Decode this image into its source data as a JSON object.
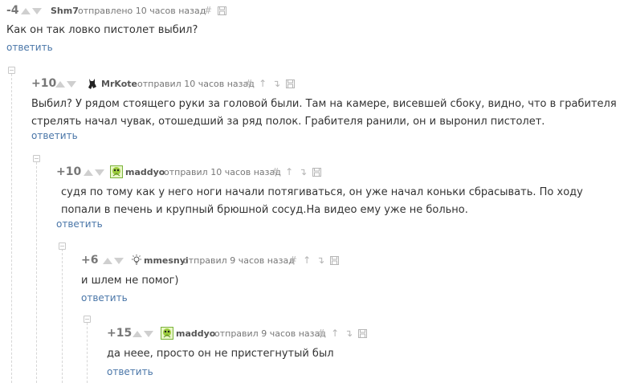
{
  "colors": {
    "reply_link": "#4a76a8",
    "vote_arrow": "#cfcfcf",
    "meta_text": "#777777"
  },
  "comments": [
    {
      "rating": "-4",
      "username": "Shm7",
      "meta": "отправлено 10 часов назад",
      "avatar_icon": "none",
      "text": "Как он так ловко пистолет выбил?",
      "reply": "ответить"
    },
    {
      "rating": "+10",
      "username": "MrKote",
      "meta": "отправил 10 часов назад",
      "avatar_icon": "cat-silhouette-icon",
      "text": "Выбил? У рядом стоящего руки за головой были. Там на камере, висевшей сбоку, видно, что в грабителя стрелять начал чувак, отошедший за ряд полок. Грабителя ранили, он и выронил пистолет.",
      "reply": "ответить"
    },
    {
      "rating": "+10",
      "username": "maddyo",
      "meta": "отправил 10 часов назад",
      "avatar_icon": "green-creature-icon",
      "text": "судя по тому как у него ноги начали потягиваться, он уже начал коньки сбрасывать. По ходу попали в печень и крупный брюшной сосуд.На видео ему уже не больно.",
      "reply": "ответить"
    },
    {
      "rating": "+6",
      "username": "mmesnyi",
      "meta": "отправил 9 часов назад",
      "avatar_icon": "lightbulb-icon",
      "text": "и шлем не помог)",
      "reply": "ответить"
    },
    {
      "rating": "+15",
      "username": "maddyo",
      "meta": "отправил 9 часов назад",
      "avatar_icon": "green-creature-icon",
      "text": "да неее, просто он не пристегнутый был",
      "reply": "ответить"
    }
  ],
  "tool_icons": [
    "hash-link-icon",
    "parent-arrow-icon",
    "branch-icon",
    "save-icon"
  ]
}
